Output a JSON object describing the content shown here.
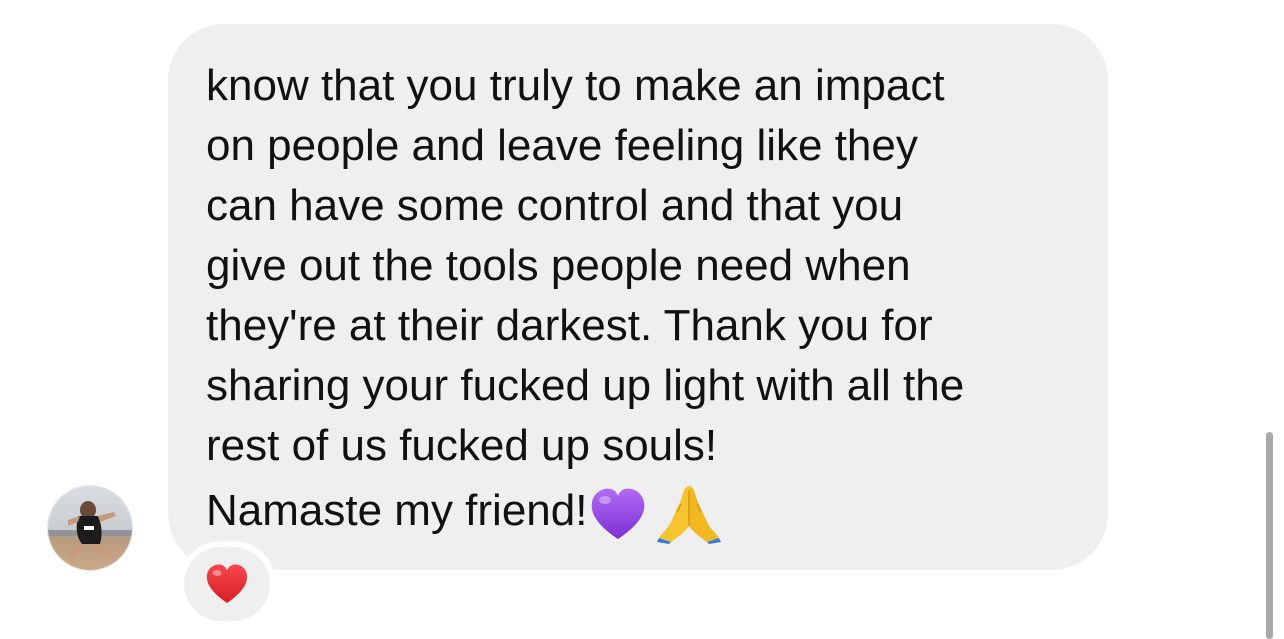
{
  "message": {
    "lines": [
      "know that you truly to make an impact",
      "on people and leave feeling like they",
      "can have some control and that you",
      "give out the tools people need when",
      "they're at their darkest. Thank you for",
      "sharing your fucked up light with all the",
      "rest of us fucked up souls!"
    ],
    "last_line_text": "Namaste my friend!",
    "last_line_emojis": [
      "purple-heart-emoji",
      "folded-hands-emoji"
    ]
  },
  "reaction": {
    "emoji": "red-heart-emoji"
  },
  "colors": {
    "bubble_background": "#efefef",
    "text": "#111111",
    "purple_heart": "#9b4fe8",
    "red_heart": "#e8262b",
    "folded_hands": "#f5c430"
  }
}
